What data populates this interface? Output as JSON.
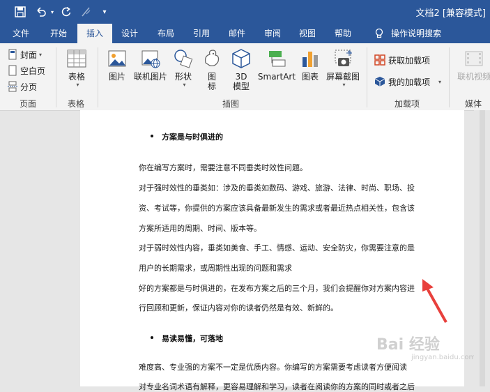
{
  "window": {
    "title": "文档2 [兼容模式]"
  },
  "quick_access": {
    "save_icon": "save-icon",
    "undo_icon": "undo-icon",
    "redo_icon": "redo-icon",
    "format_painter_icon": "format-painter-icon",
    "customize_icon": "customize-icon"
  },
  "tabs": [
    {
      "label": "文件"
    },
    {
      "label": "开始"
    },
    {
      "label": "插入",
      "active": true
    },
    {
      "label": "设计"
    },
    {
      "label": "布局"
    },
    {
      "label": "引用"
    },
    {
      "label": "邮件"
    },
    {
      "label": "审阅"
    },
    {
      "label": "视图"
    },
    {
      "label": "帮助"
    },
    {
      "label": "操作说明搜索"
    }
  ],
  "ribbon": {
    "pages": {
      "label": "页面",
      "cover": "封面",
      "blank": "空白页",
      "break": "分页"
    },
    "tables": {
      "label": "表格",
      "table": "表格"
    },
    "illustrations": {
      "label": "插图",
      "picture": "图片",
      "online_picture": "联机图片",
      "shapes": "形状",
      "icons_line1": "图",
      "icons_line2": "标",
      "model_line1": "3D",
      "model_line2": "模型",
      "smartart": "SmartArt",
      "chart": "图表",
      "screenshot": "屏幕截图"
    },
    "addins": {
      "label": "加载项",
      "get": "获取加载项",
      "mine": "我的加载项"
    },
    "media": {
      "label": "媒体",
      "online_video": "联机视频"
    }
  },
  "document": {
    "heading1": "方案是与时俱进的",
    "p1": "你在编写方案时，需要注意不同垂类时效性问题。",
    "p2_l1": "对于强时效性的垂类如：涉及的垂类如数码、游戏、旅游、法律、时尚、职场、投",
    "p2_l2": "资、考试等，你提供的方案应该具备最新发生的需求或者最近热点相关性，包含该",
    "p2_l3": "方案所适用的周期、时间、版本等。",
    "p3_l1": "对于弱时效性内容，垂类如美食、手工、情感、运动、安全防灾，你需要注意的是",
    "p3_l2": "用户的长期需求，或周期性出现的问题和需求",
    "p4_l1": "好的方案都是与时俱进的，在发布方案之后的三个月，我们会提醒你对方案内容进",
    "p4_l2": "行回顾和更新，保证内容对你的读者仍然是有效、新鲜的。",
    "heading2": "易读易懂，可落地",
    "p5_l1": "难度高、专业强的方案不一定是优质内容。你编写的方案需要考虑读者方便阅读",
    "p5_l2": "对专业名词术语有解释，更容易理解和学习，读者在阅读你的方案的同时或者之后"
  },
  "watermark": {
    "text": "Bai 经验",
    "sub": "jingyan.baidu.com"
  },
  "colors": {
    "accent": "#2b579a",
    "arrow": "#e8403c"
  }
}
